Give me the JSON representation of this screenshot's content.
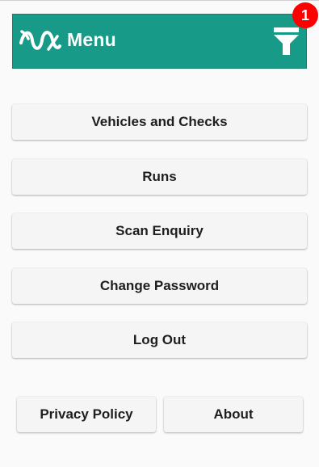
{
  "header": {
    "title": "Menu",
    "background_color": "#179a88",
    "logo_icon": "wave-logo-icon",
    "filter_icon": "filter-funnel-icon",
    "notification_count": "1",
    "badge_color": "#ff0000"
  },
  "menu": {
    "items": [
      {
        "label": "Vehicles and Checks"
      },
      {
        "label": "Runs"
      },
      {
        "label": "Scan Enquiry"
      },
      {
        "label": "Change Password"
      },
      {
        "label": "Log Out"
      }
    ]
  },
  "footer": {
    "privacy_label": "Privacy Policy",
    "about_label": "About"
  }
}
